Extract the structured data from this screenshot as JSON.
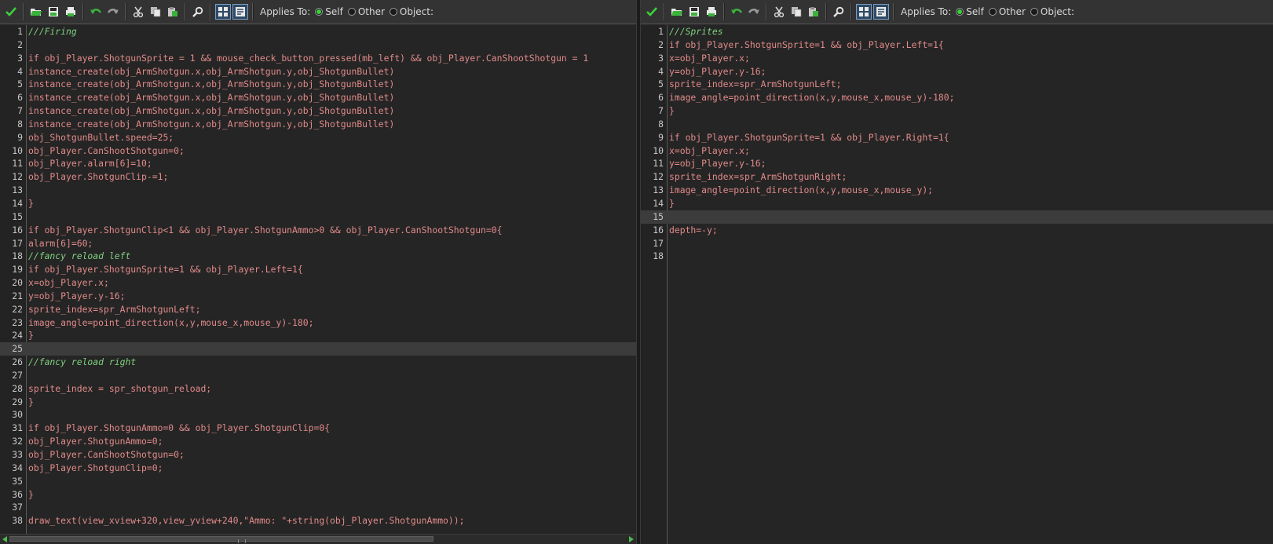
{
  "toolbar": {
    "applies_to_label": "Applies To:",
    "radio_self": "Self",
    "radio_other": "Other",
    "radio_object": "Object:"
  },
  "colors": {
    "accent_green": "#3bd13b",
    "comment": "#7fd17f",
    "code_text": "#e28a8a"
  },
  "icons": [
    "check-icon",
    "open-icon",
    "save-icon",
    "print-icon",
    "undo-icon",
    "redo-icon",
    "cut-icon",
    "copy-icon",
    "paste-icon",
    "search-icon",
    "grid-icon",
    "properties-icon"
  ],
  "left_editor": {
    "active_line": 25,
    "lines": [
      "///Firing",
      "",
      "if obj_Player.ShotgunSprite = 1 && mouse_check_button_pressed(mb_left) && obj_Player.CanShootShotgun = 1",
      "instance_create(obj_ArmShotgun.x,obj_ArmShotgun.y,obj_ShotgunBullet)",
      "instance_create(obj_ArmShotgun.x,obj_ArmShotgun.y,obj_ShotgunBullet)",
      "instance_create(obj_ArmShotgun.x,obj_ArmShotgun.y,obj_ShotgunBullet)",
      "instance_create(obj_ArmShotgun.x,obj_ArmShotgun.y,obj_ShotgunBullet)",
      "instance_create(obj_ArmShotgun.x,obj_ArmShotgun.y,obj_ShotgunBullet)",
      "obj_ShotgunBullet.speed=25;",
      "obj_Player.CanShootShotgun=0;",
      "obj_Player.alarm[6]=10;",
      "obj_Player.ShotgunClip-=1;",
      "",
      "}",
      "",
      "if obj_Player.ShotgunClip<1 && obj_Player.ShotgunAmmo>0 && obj_Player.CanShootShotgun=0{",
      "alarm[6]=60;",
      "//fancy reload left",
      "if obj_Player.ShotgunSprite=1 && obj_Player.Left=1{",
      "x=obj_Player.x;",
      "y=obj_Player.y-16;",
      "sprite_index=spr_ArmShotgunLeft;",
      "image_angle=point_direction(x,y,mouse_x,mouse_y)-180;",
      "}",
      "",
      "//fancy reload right",
      "",
      "sprite_index = spr_shotgun_reload;",
      "}",
      "",
      "if obj_Player.ShotgunAmmo=0 && obj_Player.ShotgunClip=0{",
      "obj_Player.ShotgunAmmo=0;",
      "obj_Player.CanShootShotgun=0;",
      "obj_Player.ShotgunClip=0;",
      "",
      "}",
      "",
      "draw_text(view_xview+320,view_yview+240,\"Ammo: \"+string(obj_Player.ShotgunAmmo));"
    ]
  },
  "right_editor": {
    "active_line": 15,
    "lines": [
      "///Sprites",
      "if obj_Player.ShotgunSprite=1 && obj_Player.Left=1{",
      "x=obj_Player.x;",
      "y=obj_Player.y-16;",
      "sprite_index=spr_ArmShotgunLeft;",
      "image_angle=point_direction(x,y,mouse_x,mouse_y)-180;",
      "}",
      "",
      "if obj_Player.ShotgunSprite=1 && obj_Player.Right=1{",
      "x=obj_Player.x;",
      "y=obj_Player.y-16;",
      "sprite_index=spr_ArmShotgunRight;",
      "image_angle=point_direction(x,y,mouse_x,mouse_y);",
      "}",
      "",
      "depth=-y;",
      "",
      ""
    ]
  }
}
